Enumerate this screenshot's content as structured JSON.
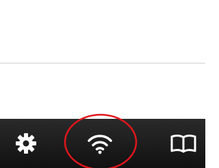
{
  "list": {
    "rows": [
      {
        "label": ""
      },
      {
        "label": ""
      }
    ]
  },
  "toolbar": {
    "buttons": [
      {
        "icon": "gear-icon"
      },
      {
        "icon": "wifi-icon"
      },
      {
        "icon": "book-icon"
      }
    ],
    "background": "#1a1a1a",
    "icon_color": "#ffffff"
  },
  "annotation": {
    "color": "#e0161c",
    "shape": "ellipse"
  }
}
